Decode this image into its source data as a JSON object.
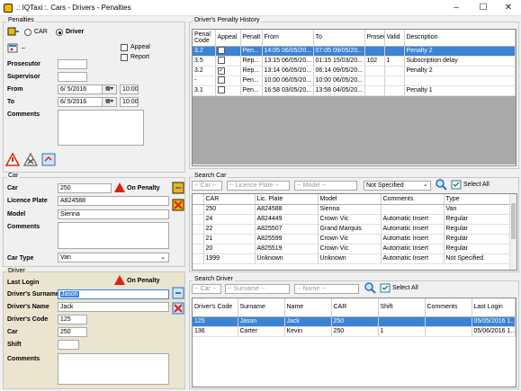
{
  "window": {
    "title": ".: IQTaxi :.  Cars - Drivers - Penalties",
    "min": "–",
    "max": "☐",
    "close": "✕"
  },
  "penalties": {
    "group_title": "Penalties",
    "radio_car": "CAR",
    "radio_driver": "Driver",
    "selected": "driver",
    "appeal": "Appeal",
    "report": "Report",
    "prosecutor_label": "Prosecutor",
    "supervisor_label": "Supervisor",
    "from_label": "From",
    "to_label": "To",
    "from_date": "6/ 5/2016",
    "from_time": "10:00",
    "to_date": "6/ 5/2016",
    "to_time": "10:00",
    "comments_label": "Comments"
  },
  "car": {
    "group_title": "Car",
    "car_label": "Car",
    "car_value": "250",
    "on_penalty": "On Penalty",
    "plate_label": "Licence Plate",
    "plate_value": "A824588",
    "model_label": "Model",
    "model_value": "Sienna",
    "comments_label": "Comments",
    "type_label": "Car Type",
    "type_value": "Van"
  },
  "driver": {
    "group_title": "Driver",
    "last_login_label": "Last Login",
    "on_penalty": "On Penalty",
    "surname_label": "Driver's Surname",
    "surname_value": "Jason",
    "name_label": "Driver's Name",
    "name_value": "Jack",
    "code_label": "Driver's Code",
    "code_value": "125",
    "car_label": "Car",
    "car_value": "250",
    "shift_label": "Shift",
    "shift_value": "",
    "comments_label": "Comments"
  },
  "history": {
    "title": "Driver's Penalty History",
    "columns": [
      "Penal Code",
      "Appeal",
      "Penalt",
      "From",
      "To",
      "Prosec",
      "Valid",
      "Description"
    ],
    "rows": [
      {
        "code": "3.2",
        "appeal": false,
        "penalty": "Pen...",
        "from": "14:05 06/05/20...",
        "to": "07:05 09/05/20...",
        "prosec": "",
        "valid": "",
        "desc": "Penalty 2",
        "selected": true
      },
      {
        "code": "3.5",
        "appeal": false,
        "penalty": "Rep...",
        "from": "13:15 06/05/20...",
        "to": "01:15 15/03/20...",
        "prosec": "102",
        "valid": "1",
        "desc": "Subscription delay",
        "selected": false
      },
      {
        "code": "3.2",
        "appeal": true,
        "penalty": "Rep...",
        "from": "13:14 06/05/20...",
        "to": "06:14 09/05/20...",
        "prosec": "",
        "valid": "",
        "desc": "Penalty 2",
        "selected": false
      },
      {
        "code": "-",
        "appeal": false,
        "penalty": "Pen...",
        "from": "10:00 06/05/20...",
        "to": "10:00 06/05/20...",
        "prosec": "",
        "valid": "",
        "desc": "",
        "selected": false
      },
      {
        "code": "3.1",
        "appeal": false,
        "penalty": "Pen...",
        "from": "16:58 03/05/20...",
        "to": "13:58 04/05/20...",
        "prosec": "",
        "valid": "",
        "desc": "Penalty 1",
        "selected": false
      }
    ]
  },
  "search_car": {
    "title": "Search Car",
    "f_car": "-- Car --",
    "f_plate": "-- Licence Plate --",
    "f_model": "-- Model --",
    "f_type": "Not Specified",
    "select_all": "Select All",
    "columns": [
      "CAR",
      "Lic. Plate",
      "Model",
      "Comments",
      "Type"
    ],
    "rows": [
      {
        "car": "250",
        "plate": "A824588",
        "model": "Sienna",
        "comments": "",
        "type": "Van"
      },
      {
        "car": "24",
        "plate": "A824449",
        "model": "Crown Vic",
        "comments": "Automatic Insert",
        "type": "Regular"
      },
      {
        "car": "22",
        "plate": "A825507",
        "model": "Grand Marquis",
        "comments": "Automatic Insert",
        "type": "Regular"
      },
      {
        "car": "21",
        "plate": "A825599",
        "model": " Crown Vic",
        "comments": "Automatic Insert",
        "type": "Regular"
      },
      {
        "car": "20",
        "plate": "A825519",
        "model": " Crown Vic",
        "comments": "Automatic Insert",
        "type": "Regular"
      },
      {
        "car": "1999",
        "plate": "Unknown",
        "model": "Unknown",
        "comments": "Automatic Insert",
        "type": "Not Specified"
      }
    ]
  },
  "search_driver": {
    "title": "Search Driver",
    "f_car": "-- Car --",
    "f_surname": "-- Surname --",
    "f_name": "-- Name --",
    "select_all": "Select All",
    "columns": [
      "Driver's Code",
      "Surname",
      "Name",
      "CAR",
      "Shift",
      "Comments",
      "Last Login"
    ],
    "rows": [
      {
        "code": "125",
        "surname": "Jason",
        "name": "Jack",
        "car": "250",
        "shift": "",
        "comments": "",
        "login": "05/05/2016 1...",
        "selected": true
      },
      {
        "code": "136",
        "surname": "Carter",
        "name": "Kevin",
        "car": "250",
        "shift": "1",
        "comments": "",
        "login": "05/06/2016 1...",
        "selected": false
      }
    ]
  },
  "colors": {
    "selection": "#3b83d6",
    "driver_panel": "#ebe4cf",
    "empty_grid": "#a9a9a9",
    "accent_icon": "#f2b600"
  }
}
